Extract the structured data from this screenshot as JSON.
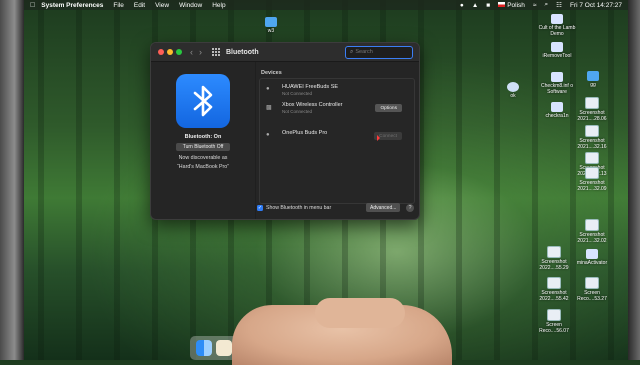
{
  "menubar": {
    "app_name": "System Preferences",
    "items": [
      "File",
      "Edit",
      "View",
      "Window",
      "Help"
    ],
    "input_language": "Polish",
    "datetime": "Fri 7 Oct  14:27:27"
  },
  "window": {
    "title": "Bluetooth",
    "search_placeholder": "Search",
    "status": "Bluetooth: On",
    "toggle_label": "Turn Bluetooth Off",
    "discoverable_line1": "Now discoverable as",
    "discoverable_line2": "“Hard's MacBook Pro”",
    "devices_header": "Devices",
    "devices": [
      {
        "name": "HUAWEI FreeBuds SE",
        "status": "Not Connected",
        "button": ""
      },
      {
        "name": "Xbox Wireless Controller",
        "status": "Not Connected",
        "button": "Options"
      },
      {
        "name": "OnePlus Buds Pro",
        "status": "",
        "button": "Connect"
      }
    ],
    "show_in_menu_bar_label": "Show Bluetooth in menu bar",
    "show_in_menu_bar_checked": true,
    "advanced_label": "Advanced...",
    "help_label": "?"
  },
  "desktop": {
    "icons": [
      {
        "label": "w3",
        "kind": "folder"
      },
      {
        "label": "Cult of the Lamb Demo",
        "kind": "app"
      },
      {
        "label": "iRemoveTool",
        "kind": "app"
      },
      {
        "label": "gg",
        "kind": "folder"
      },
      {
        "label": "ok",
        "kind": "circle"
      },
      {
        "label": "Checkm8.inf o Software",
        "kind": "app"
      },
      {
        "label": "Screenshot 2021....28.06",
        "kind": "shot"
      },
      {
        "label": "checkra1n",
        "kind": "app"
      },
      {
        "label": "Screenshot 2021....32.16",
        "kind": "shot"
      },
      {
        "label": "Screenshot 2021....32.13",
        "kind": "shot"
      },
      {
        "label": "Screenshot 2021....32.09",
        "kind": "shot"
      },
      {
        "label": "Screenshot 2021....32.02",
        "kind": "shot"
      },
      {
        "label": "Screenshot 2022....55.29",
        "kind": "shot"
      },
      {
        "label": "minaActivator",
        "kind": "app"
      },
      {
        "label": "Screenshot 2022....55.42",
        "kind": "shot"
      },
      {
        "label": "Screen Reco....53.27",
        "kind": "shot"
      },
      {
        "label": "Screen Reco....56.07",
        "kind": "shot"
      }
    ]
  }
}
